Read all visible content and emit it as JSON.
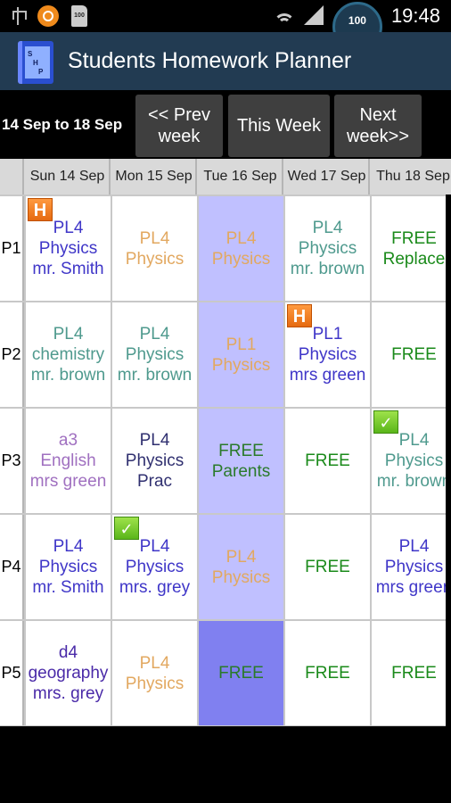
{
  "status_bar": {
    "time": "19:48",
    "battery": "100",
    "sd_label": "100",
    "icons": [
      "usb-icon",
      "sync-icon",
      "sd-card-icon",
      "wifi-icon",
      "signal-icon",
      "battery-gauge-icon"
    ]
  },
  "app": {
    "title": "Students Homework Planner",
    "icon_letters": [
      "S",
      "H",
      "P"
    ]
  },
  "week_nav": {
    "range": "14 Sep to 18 Sep",
    "prev_label": "<< Prev week",
    "this_label": "This Week",
    "next_label": "Next week>>"
  },
  "days": [
    "Sun 14 Sep",
    "Mon 15 Sep",
    "Tue 16 Sep",
    "Wed 17 Sep",
    "Thu 18 Sep"
  ],
  "periods": [
    "P1",
    "P2",
    "P3",
    "P4",
    "P5"
  ],
  "colors": {
    "today_column": "#c0c0ff",
    "today_current": "#8080f0",
    "header_bg": "#d9d9d9",
    "title_bar": "#223b52"
  },
  "cells": [
    [
      {
        "lines": [
          "PL4",
          "Physics",
          "mr. Smith"
        ],
        "color": "c-purple",
        "badge": "H"
      },
      {
        "lines": [
          "PL4",
          "Physics"
        ],
        "color": "c-orange"
      },
      {
        "lines": [
          "PL4",
          "Physics"
        ],
        "color": "c-orange",
        "today": true
      },
      {
        "lines": [
          "PL4",
          "Physics",
          "mr. brown"
        ],
        "color": "c-teal"
      },
      {
        "lines": [
          "FREE",
          "Replace"
        ],
        "color": "c-green"
      }
    ],
    [
      {
        "lines": [
          "PL4",
          "chemistry",
          "mr. brown"
        ],
        "color": "c-teal"
      },
      {
        "lines": [
          "PL4",
          "Physics",
          "mr. brown"
        ],
        "color": "c-teal"
      },
      {
        "lines": [
          "PL1",
          "Physics"
        ],
        "color": "c-orange",
        "today": true
      },
      {
        "lines": [
          "PL1",
          "Physics",
          "mrs green"
        ],
        "color": "c-purple",
        "badge": "H"
      },
      {
        "lines": [
          "FREE"
        ],
        "color": "c-green"
      }
    ],
    [
      {
        "lines": [
          "a3",
          "English",
          "mrs green"
        ],
        "color": "c-lavender"
      },
      {
        "lines": [
          "PL4",
          "Physics",
          "Prac"
        ],
        "color": "c-navy"
      },
      {
        "lines": [
          "FREE",
          "Parents"
        ],
        "color": "c-darkgreen",
        "today": true
      },
      {
        "lines": [
          "FREE"
        ],
        "color": "c-green"
      },
      {
        "lines": [
          "PL4",
          "Physics",
          "mr. brown"
        ],
        "color": "c-teal",
        "badge": "✓"
      }
    ],
    [
      {
        "lines": [
          "PL4",
          "Physics",
          "mr. Smith"
        ],
        "color": "c-purple"
      },
      {
        "lines": [
          "PL4",
          "Physics",
          "mrs. grey"
        ],
        "color": "c-purple",
        "badge": "✓"
      },
      {
        "lines": [
          "PL4",
          "Physics"
        ],
        "color": "c-orange",
        "today": true
      },
      {
        "lines": [
          "FREE"
        ],
        "color": "c-green"
      },
      {
        "lines": [
          "PL4",
          "Physics",
          "mrs green"
        ],
        "color": "c-purple"
      }
    ],
    [
      {
        "lines": [
          "d4",
          "geography",
          "mrs. grey"
        ],
        "color": "c-darkpurple"
      },
      {
        "lines": [
          "PL4",
          "Physics"
        ],
        "color": "c-orange"
      },
      {
        "lines": [
          "FREE"
        ],
        "color": "c-darkgreen",
        "today": true,
        "current": true
      },
      {
        "lines": [
          "FREE"
        ],
        "color": "c-green"
      },
      {
        "lines": [
          "FREE"
        ],
        "color": "c-green"
      }
    ]
  ]
}
